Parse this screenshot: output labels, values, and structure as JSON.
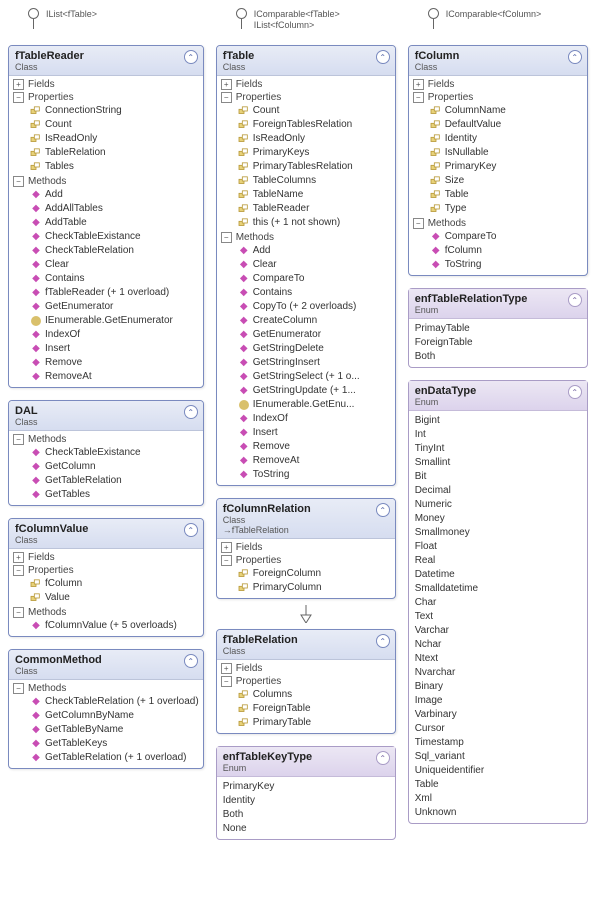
{
  "labels": {
    "class": "Class",
    "enum": "Enum",
    "fields": "Fields",
    "props": "Properties",
    "methods": "Methods"
  },
  "col1": {
    "lollipop": "IList<fTable>",
    "fTableReader": {
      "name": "fTableReader",
      "props": [
        "ConnectionString",
        "Count",
        "IsReadOnly",
        "TableRelation",
        "Tables"
      ],
      "methods": [
        "Add",
        "AddAllTables",
        "AddTable",
        "CheckTableExistance",
        "CheckTableRelation",
        "Clear",
        "Contains",
        "fTableReader (+ 1 overload)",
        "GetEnumerator",
        "IEnumerable.GetEnumerator",
        "IndexOf",
        "Insert",
        "Remove",
        "RemoveAt"
      ]
    },
    "DAL": {
      "name": "DAL",
      "methods": [
        "CheckTableExistance",
        "GetColumn",
        "GetTableRelation",
        "GetTables"
      ]
    },
    "fColumnValue": {
      "name": "fColumnValue",
      "props": [
        "fColumn",
        "Value"
      ],
      "methods": [
        "fColumnValue (+ 5 overloads)"
      ]
    },
    "CommonMethod": {
      "name": "CommonMethod",
      "methods": [
        "CheckTableRelation (+ 1 overload)",
        "GetColumnByName",
        "GetTableByName",
        "GetTableKeys",
        "GetTableRelation (+ 1 overload)"
      ]
    }
  },
  "col2": {
    "lollipop": "IComparable<fTable>\nIList<fColumn>",
    "fTable": {
      "name": "fTable",
      "props": [
        "Count",
        "ForeignTablesRelation",
        "IsReadOnly",
        "PrimaryKeys",
        "PrimaryTablesRelation",
        "TableColumns",
        "TableName",
        "TableReader",
        "this (+ 1 not shown)"
      ],
      "methods": [
        "Add",
        "Clear",
        "CompareTo",
        "Contains",
        "CopyTo (+ 2 overloads)",
        "CreateColumn",
        "GetEnumerator",
        "GetStringDelete",
        "GetStringInsert",
        "GetStringSelect (+ 1 o...",
        "GetStringUpdate (+ 1...",
        "IEnumerable.GetEnu...",
        "IndexOf",
        "Insert",
        "Remove",
        "RemoveAt",
        "ToString"
      ]
    },
    "fColumnRelation": {
      "name": "fColumnRelation",
      "base": "→fTableRelation",
      "props": [
        "ForeignColumn",
        "PrimaryColumn"
      ]
    },
    "fTableRelation": {
      "name": "fTableRelation",
      "props": [
        "Columns",
        "ForeignTable",
        "PrimaryTable"
      ]
    },
    "enfTableKeyType": {
      "name": "enfTableKeyType",
      "items": [
        "PrimaryKey",
        "Identity",
        "Both",
        "None"
      ]
    }
  },
  "col3": {
    "lollipop": "IComparable<fColumn>",
    "fColumn": {
      "name": "fColumn",
      "props": [
        "ColumnName",
        "DefaultValue",
        "Identity",
        "IsNullable",
        "PrimaryKey",
        "Size",
        "Table",
        "Type"
      ],
      "methods": [
        "CompareTo",
        "fColumn",
        "ToString"
      ]
    },
    "enfTableRelationType": {
      "name": "enfTableRelationType",
      "items": [
        "PrimayTable",
        "ForeignTable",
        "Both"
      ]
    },
    "enDataType": {
      "name": "enDataType",
      "items": [
        "Bigint",
        "Int",
        "TinyInt",
        "Smallint",
        "Bit",
        "Decimal",
        "Numeric",
        "Money",
        "Smallmoney",
        "Float",
        "Real",
        "Datetime",
        "Smalldatetime",
        "Char",
        "Text",
        "Varchar",
        "Nchar",
        "Ntext",
        "Nvarchar",
        "Binary",
        "Image",
        "Varbinary",
        "Cursor",
        "Timestamp",
        "Sql_variant",
        "Uniqueidentifier",
        "Table",
        "Xml",
        "Unknown"
      ]
    }
  }
}
